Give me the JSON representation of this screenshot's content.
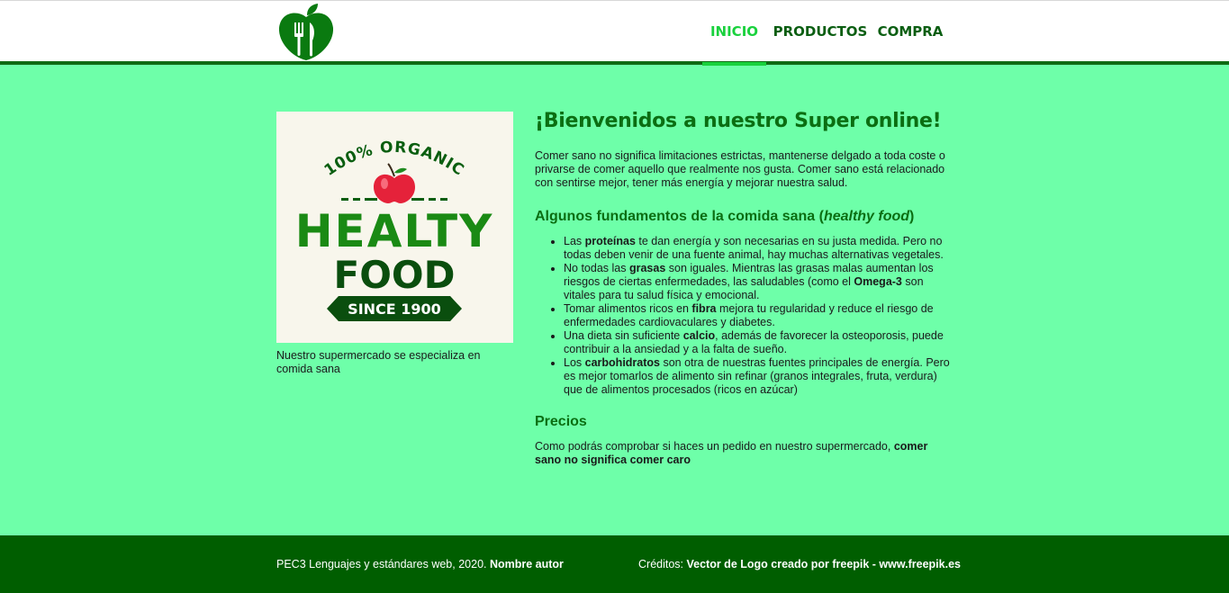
{
  "nav": {
    "items": [
      {
        "label": "INICIO"
      },
      {
        "label": "PRODUCTOS"
      },
      {
        "label": "COMPRA"
      }
    ]
  },
  "hero": {
    "badge_top": "100% ORGANIC",
    "badge_line1": "HEALTY",
    "badge_line2": "FOOD",
    "badge_ribbon": "SINCE 1900",
    "caption": "Nuestro supermercado se especializa en comida sana"
  },
  "main": {
    "title": "¡Bienvenidos a nuestro Super online!",
    "intro": "Comer sano no significa limitaciones estrictas, mantenerse delgado a toda coste o privarse de comer aquello que realmente nos gusta. Comer sano está relacionado con sentirse mejor, tener más energía y mejorar nuestra salud.",
    "sub_prefix": "Algunos fundamentos de la comida sana (",
    "sub_italic": "healthy food",
    "sub_suffix": ")",
    "facts": [
      {
        "pre": "Las ",
        "bold": "proteínas",
        "post": " te dan energía y son necesarias en su justa medida. Pero no todas deben venir de una fuente animal, hay muchas alternativas vegetales."
      },
      {
        "pre": "No todas las ",
        "bold": "grasas",
        "post": " son iguales. Mientras las grasas malas aumentan los riesgos de ciertas enfermedades, las saludables (como el ",
        "bold2": "Omega-3",
        "post2": " son vitales para tu salud física y emocional."
      },
      {
        "pre": "Tomar alimentos ricos en ",
        "bold": "fibra",
        "post": " mejora tu regularidad y reduce el riesgo de enfermedades cardiovaculares y diabetes."
      },
      {
        "pre": "Una dieta sin suficiente ",
        "bold": "calcio",
        "post": ", además de favorecer la osteoporosis, puede contribuir a la ansiedad y a la falta de sueño."
      },
      {
        "pre": "Los ",
        "bold": "carbohidratos",
        "post": " son otra de nuestras fuentes principales de energía. Pero es mejor tomarlos de alimento sin refinar (granos integrales, fruta, verdura) que de alimentos procesados (ricos en azúcar)"
      }
    ],
    "prices_title": "Precios",
    "prices_text": "Como podrás comprobar si haces un pedido en nuestro supermercado, ",
    "prices_bold": "comer sano no significa comer caro"
  },
  "footer": {
    "left_text": "PEC3 Lenguajes y estándares web, 2020. ",
    "left_bold": "Nombre autor",
    "right_text": "Créditos: ",
    "right_bold": "Vector de Logo creado por freepik - www.freepik.es"
  },
  "colors": {
    "background": "#6effa9",
    "dark_green": "#005e00",
    "accent": "#19d13d"
  }
}
